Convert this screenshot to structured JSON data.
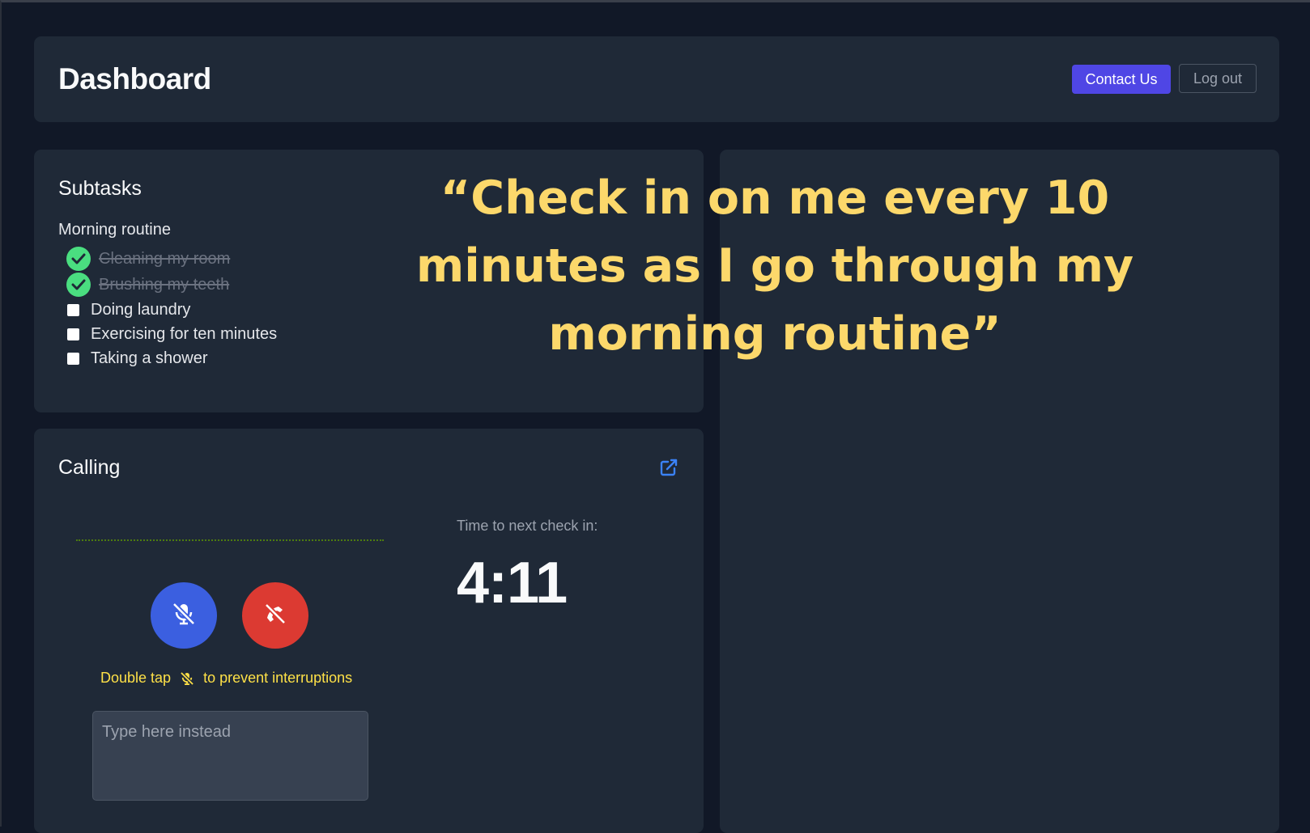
{
  "header": {
    "title": "Dashboard",
    "contact_label": "Contact Us",
    "logout_label": "Log out"
  },
  "subtasks": {
    "title": "Subtasks",
    "routine_name": "Morning routine",
    "items": [
      {
        "label": "Cleaning my room",
        "done": true
      },
      {
        "label": "Brushing my teeth",
        "done": true
      },
      {
        "label": "Doing laundry",
        "done": false
      },
      {
        "label": "Exercising for ten minutes",
        "done": false
      },
      {
        "label": "Taking a shower",
        "done": false
      }
    ]
  },
  "calling": {
    "title": "Calling",
    "hint_before": "Double tap",
    "hint_after": "to prevent interruptions",
    "input_placeholder": "Type here instead",
    "timer_label": "Time to next check in:",
    "timer_value": "4:11"
  },
  "quote": "“Check in on me every 10 minutes as I go through my morning routine”",
  "icons": {
    "open": "external-link-icon",
    "mute": "mic-off-icon",
    "hangup": "phone-off-icon",
    "check": "check-circle-icon"
  },
  "colors": {
    "background": "#111827",
    "card": "#1f2937",
    "primary": "#4f46e5",
    "mute_button": "#3b5fe0",
    "hangup_button": "#dc3a32",
    "done_check": "#4ade80",
    "hint_text": "#fde047",
    "quote_text": "#fcd86b"
  }
}
